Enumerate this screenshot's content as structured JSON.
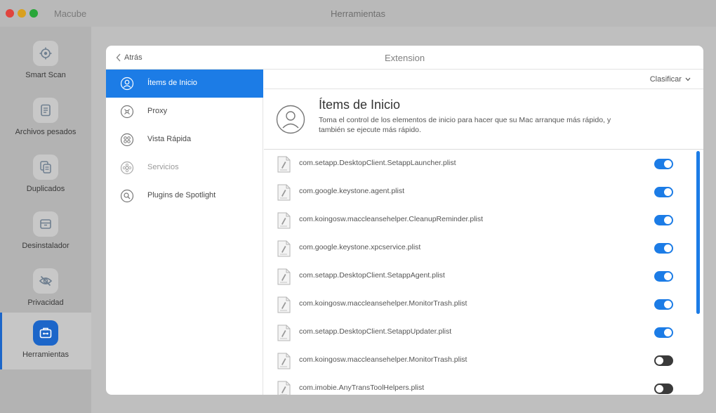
{
  "window": {
    "app_name": "Macube",
    "title": "Herramientas"
  },
  "sidebar": {
    "items": [
      {
        "label": "Smart Scan",
        "icon": "target-icon"
      },
      {
        "label": "Archivos pesados",
        "icon": "document-icon"
      },
      {
        "label": "Duplicados",
        "icon": "duplicate-icon"
      },
      {
        "label": "Desinstalador",
        "icon": "box-icon"
      },
      {
        "label": "Privacidad",
        "icon": "eye-slash-icon"
      },
      {
        "label": "Herramientas",
        "icon": "toolbox-icon",
        "active": true
      }
    ]
  },
  "panel": {
    "back_label": "Atrás",
    "title": "Extension",
    "sort_label": "Clasificar"
  },
  "categories": [
    {
      "label": "Ítems de Inicio",
      "icon": "user-icon",
      "active": true
    },
    {
      "label": "Proxy",
      "icon": "proxy-icon"
    },
    {
      "label": "Vista Rápida",
      "icon": "quicklook-icon"
    },
    {
      "label": "Servicios",
      "icon": "services-icon",
      "disabled": true
    },
    {
      "label": "Plugins de Spotlight",
      "icon": "spotlight-icon"
    }
  ],
  "info": {
    "title": "Ítems de Inicio",
    "description": "Toma el control de los elementos de inicio para hacer que su Mac arranque más rápido, y también se ejecute más rápido."
  },
  "items": [
    {
      "name": "com.setapp.DesktopClient.SetappLauncher.plist",
      "enabled": true
    },
    {
      "name": "com.google.keystone.agent.plist",
      "enabled": true
    },
    {
      "name": "com.koingosw.maccleansehelper.CleanupReminder.plist",
      "enabled": true
    },
    {
      "name": "com.google.keystone.xpcservice.plist",
      "enabled": true
    },
    {
      "name": "com.setapp.DesktopClient.SetappAgent.plist",
      "enabled": true
    },
    {
      "name": "com.koingosw.maccleansehelper.MonitorTrash.plist",
      "enabled": true
    },
    {
      "name": "com.setapp.DesktopClient.SetappUpdater.plist",
      "enabled": true
    },
    {
      "name": "com.koingosw.maccleansehelper.MonitorTrash.plist",
      "enabled": false
    },
    {
      "name": "com.imobie.AnyTransToolHelpers.plist",
      "enabled": false
    }
  ],
  "colors": {
    "accent": "#1c7ce6",
    "sidebar_accent": "#1c66c9",
    "toggle_off": "#3a3a3a"
  }
}
